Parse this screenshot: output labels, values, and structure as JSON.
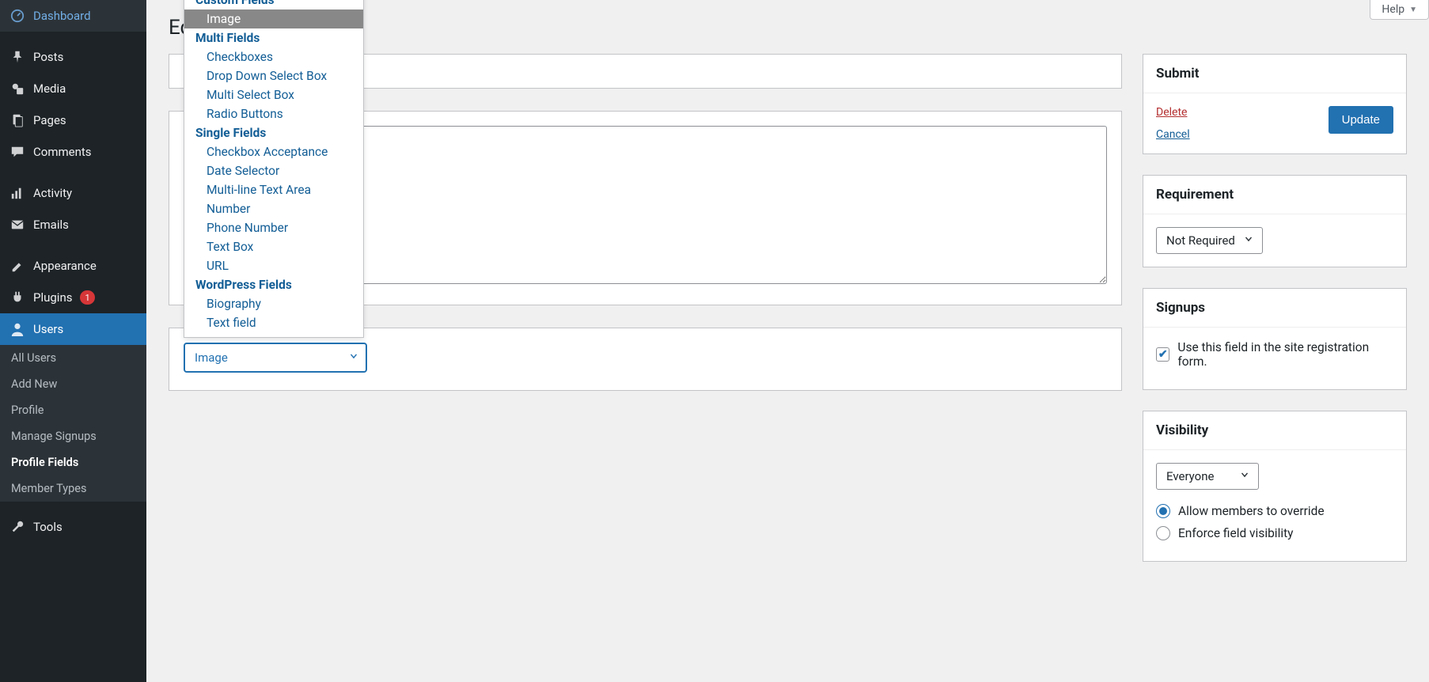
{
  "help_label": "Help",
  "page_title": "Edit Field",
  "sidebar": {
    "items": [
      {
        "label": "Dashboard",
        "icon": "dashboard-icon"
      },
      {
        "label": "Posts",
        "icon": "pin-icon"
      },
      {
        "label": "Media",
        "icon": "media-icon"
      },
      {
        "label": "Pages",
        "icon": "pages-icon"
      },
      {
        "label": "Comments",
        "icon": "comments-icon"
      },
      {
        "label": "Activity",
        "icon": "activity-icon"
      },
      {
        "label": "Emails",
        "icon": "emails-icon"
      },
      {
        "label": "Appearance",
        "icon": "appearance-icon"
      },
      {
        "label": "Plugins",
        "icon": "plugins-icon",
        "badge": "1"
      },
      {
        "label": "Users",
        "icon": "users-icon",
        "active": true
      },
      {
        "label": "Tools",
        "icon": "tools-icon"
      }
    ],
    "users_sub": [
      {
        "label": "All Users"
      },
      {
        "label": "Add New"
      },
      {
        "label": "Profile"
      },
      {
        "label": "Manage Signups"
      },
      {
        "label": "Profile Fields",
        "current": true
      },
      {
        "label": "Member Types"
      }
    ]
  },
  "type_select": {
    "value": "Image",
    "groups": [
      {
        "label": "Custom Fields",
        "options": [
          "Image"
        ]
      },
      {
        "label": "Multi Fields",
        "options": [
          "Checkboxes",
          "Drop Down Select Box",
          "Multi Select Box",
          "Radio Buttons"
        ]
      },
      {
        "label": "Single Fields",
        "options": [
          "Checkbox Acceptance",
          "Date Selector",
          "Multi-line Text Area",
          "Number",
          "Phone Number",
          "Text Box",
          "URL"
        ]
      },
      {
        "label": "WordPress Fields",
        "options": [
          "Biography",
          "Text field"
        ]
      }
    ]
  },
  "submit_box": {
    "title": "Submit",
    "delete": "Delete",
    "cancel": "Cancel",
    "update": "Update"
  },
  "requirement_box": {
    "title": "Requirement",
    "value": "Not Required"
  },
  "signups_box": {
    "title": "Signups",
    "checkbox_label": "Use this field in the site registration form.",
    "checked": true
  },
  "visibility_box": {
    "title": "Visibility",
    "value": "Everyone",
    "radios": [
      {
        "label": "Allow members to override",
        "checked": true
      },
      {
        "label": "Enforce field visibility",
        "checked": false
      }
    ]
  }
}
